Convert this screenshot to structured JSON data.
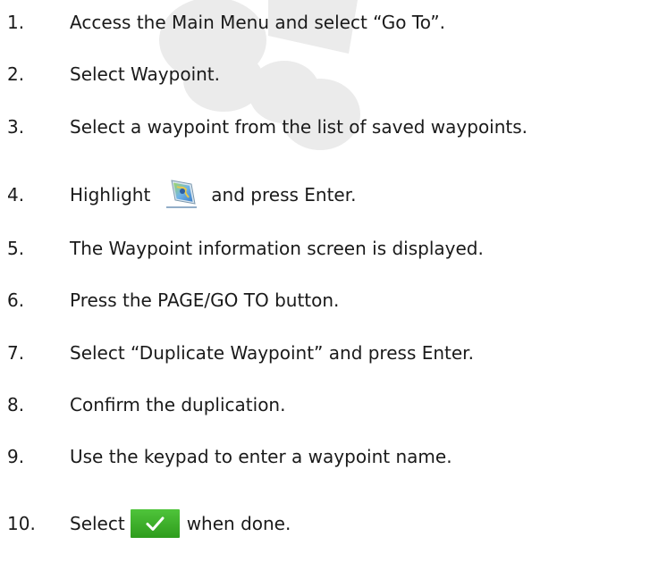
{
  "steps": [
    {
      "num": "1.",
      "text": "Access the Main Menu and select “Go To”."
    },
    {
      "num": "2.",
      "text": "Select Waypoint."
    },
    {
      "num": "3.",
      "text": "Select a waypoint from the list of saved waypoints."
    },
    {
      "num": "4.",
      "text_before": "Highlight",
      "icon": "map-waypoint-icon",
      "text_after": "and press Enter."
    },
    {
      "num": "5.",
      "text": "The Waypoint information screen is displayed."
    },
    {
      "num": "6.",
      "text": "Press the PAGE/GO TO button."
    },
    {
      "num": "7.",
      "text": "Select “Duplicate Waypoint” and press Enter."
    },
    {
      "num": "8.",
      "text": "Confirm the duplication."
    },
    {
      "num": "9.",
      "text": "Use the keypad to enter a waypoint name."
    },
    {
      "num": "10.",
      "text_before": "Select",
      "icon": "checkmark-icon",
      "text_after": "when done."
    }
  ],
  "colors": {
    "text": "#1a1a1a",
    "watermark": "#ebebeb",
    "check_button": "#3aad28"
  }
}
